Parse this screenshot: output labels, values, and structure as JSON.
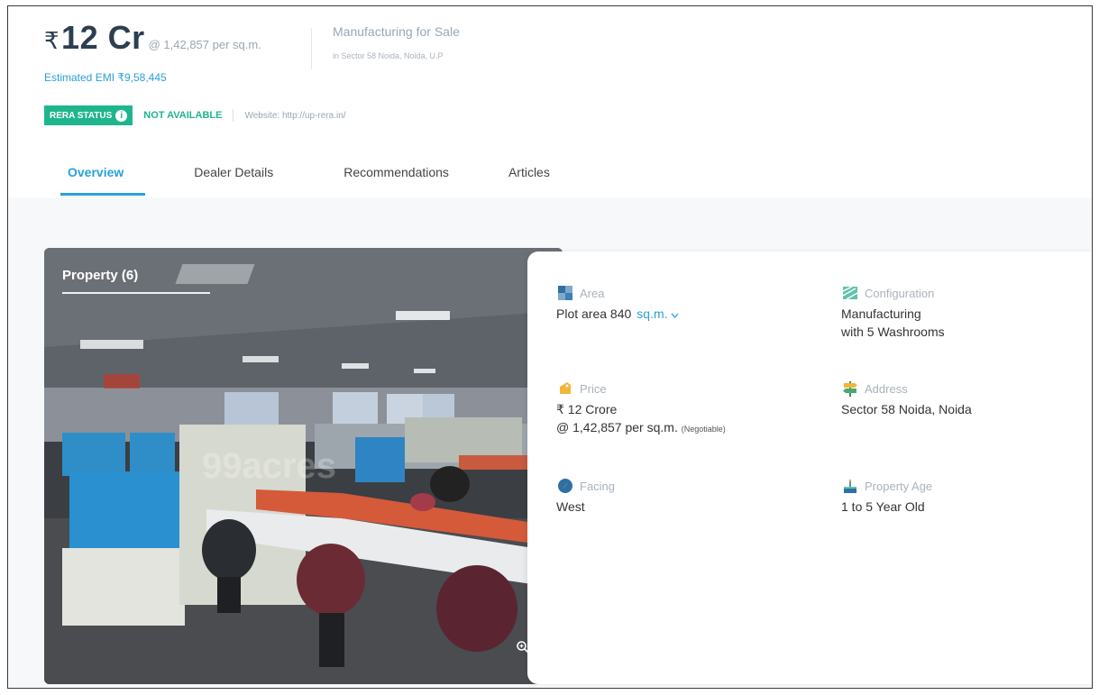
{
  "header": {
    "currency_symbol": "₹",
    "price": "12 Cr",
    "price_per": "@ 1,42,857 per sq.m.",
    "emi": "Estimated EMI ₹9,58,445",
    "property_type": "Manufacturing for Sale",
    "location": "in Sector 58 Noida, Noida, U.P"
  },
  "rera": {
    "badge_label": "RERA STATUS",
    "info_icon": "i",
    "status": "NOT AVAILABLE",
    "website": "Website: http://up-rera.in/"
  },
  "tabs": [
    {
      "label": "Overview",
      "active": true
    },
    {
      "label": "Dealer Details",
      "active": false
    },
    {
      "label": "Recommendations",
      "active": false
    },
    {
      "label": "Articles",
      "active": false
    }
  ],
  "gallery": {
    "label": "Property (6)",
    "zoom_icon": "zoom-in-icon",
    "watermark": "99acres"
  },
  "details": {
    "area": {
      "title": "Area",
      "value": "Plot area 840",
      "unit": "sq.m."
    },
    "configuration": {
      "title": "Configuration",
      "line1": "Manufacturing",
      "line2": "with 5 Washrooms"
    },
    "price": {
      "title": "Price",
      "line1": "₹ 12 Crore",
      "line2": "@ 1,42,857 per sq.m.",
      "note": "(Negotiable)"
    },
    "address": {
      "title": "Address",
      "value": "Sector 58 Noida, Noida"
    },
    "facing": {
      "title": "Facing",
      "value": "West"
    },
    "property_age": {
      "title": "Property Age",
      "value": "1 to 5 Year Old"
    }
  },
  "colors": {
    "accent_blue": "#2aa0d8",
    "rera_green": "#1fb58d",
    "price_text": "#2c3e50"
  }
}
